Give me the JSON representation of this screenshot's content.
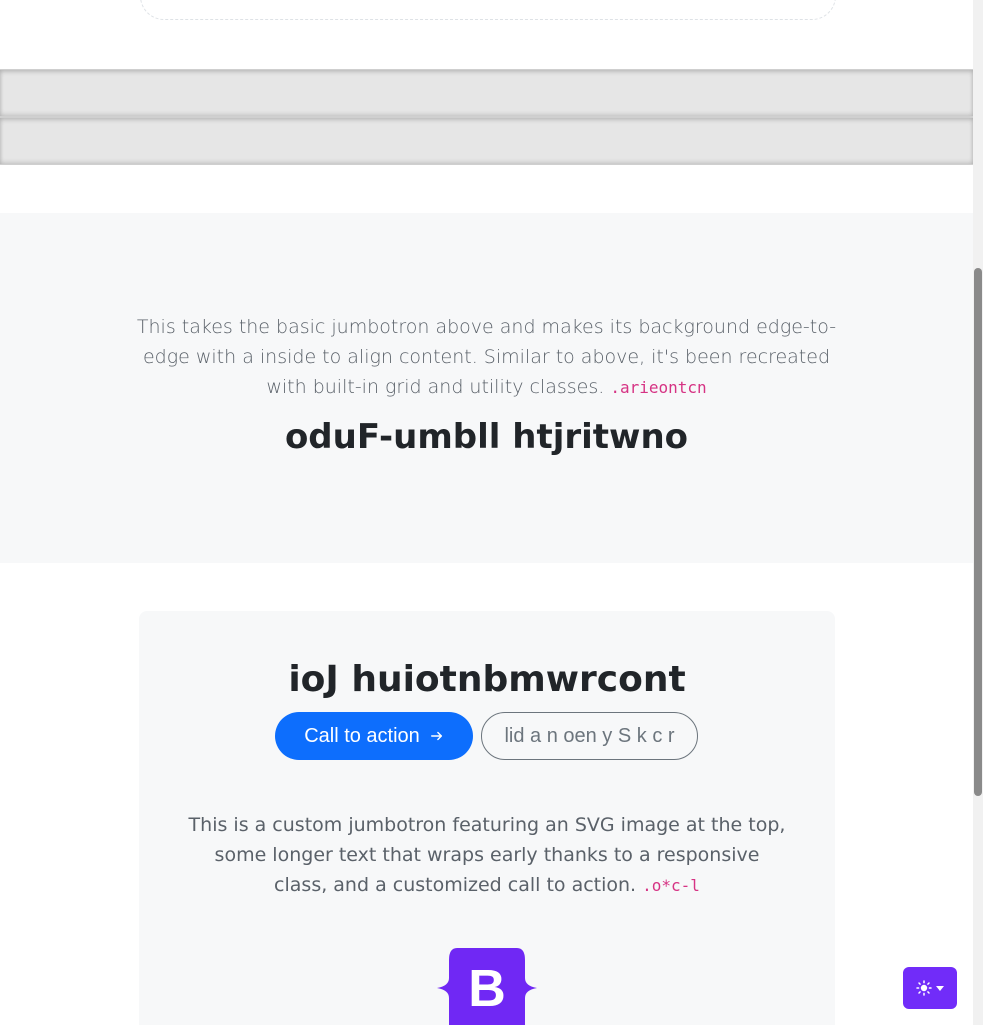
{
  "fluid_jumbotron": {
    "lead_text": "This takes the basic jumbotron above and makes its background edge-to-edge with a inside to align content. Similar to above, it's been recreated with built-in grid and utility classes. ",
    "lead_code": ".arieontcn",
    "title": "oduF-umbll htjritwno"
  },
  "custom_jumbotron": {
    "title": "ioJ huiotnbmwrcont",
    "primary_button": "Call to action",
    "primary_button_icon": "arrow-right-icon",
    "secondary_button": "lid a n oen y S k c r",
    "lead_text": "This is a custom jumbotron featuring an SVG image at the top, some longer text that wraps early thanks to a responsive class, and a customized call to action. ",
    "lead_code": ".o*c-l",
    "logo_letter": "B"
  },
  "theme_toggle": {
    "icon": "sun-icon"
  },
  "colors": {
    "primary": "#0d6efd",
    "brand": "#712cf9",
    "code": "#d63384",
    "section_bg": "#f7f8f9"
  }
}
